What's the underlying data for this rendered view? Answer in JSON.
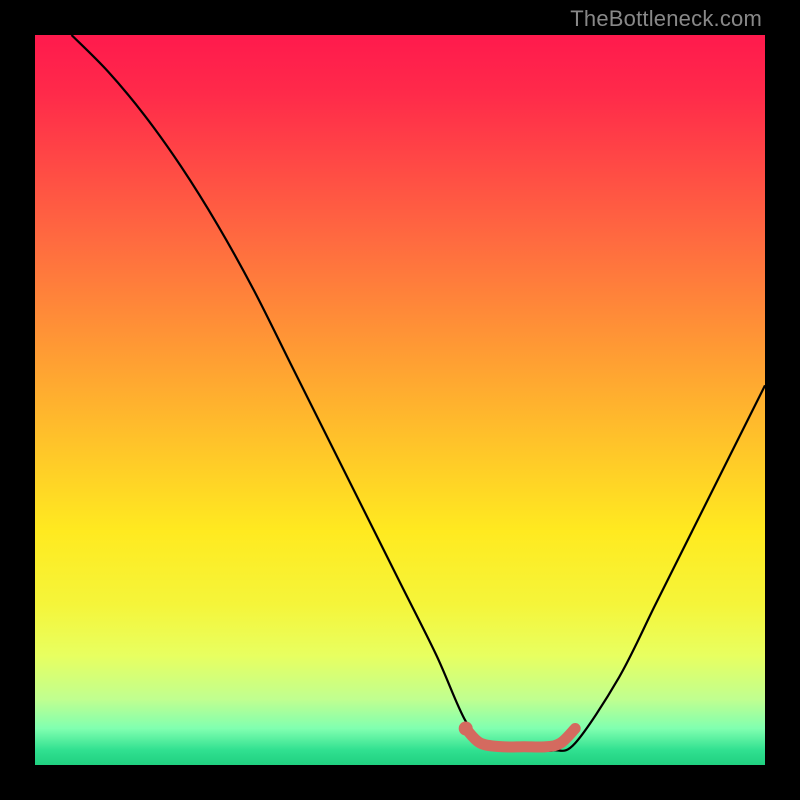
{
  "watermark": "TheBottleneck.com",
  "chart_data": {
    "type": "line",
    "title": "",
    "xlabel": "",
    "ylabel": "",
    "xlim": [
      0,
      100
    ],
    "ylim": [
      0,
      100
    ],
    "series": [
      {
        "name": "bottleneck-curve",
        "x": [
          5,
          10,
          15,
          20,
          25,
          30,
          35,
          40,
          45,
          50,
          55,
          59,
          62,
          65,
          68,
          71,
          74,
          80,
          85,
          90,
          95,
          100
        ],
        "y": [
          100,
          95,
          89,
          82,
          74,
          65,
          55,
          45,
          35,
          25,
          15,
          6,
          3,
          2,
          2,
          2,
          3,
          12,
          22,
          32,
          42,
          52
        ]
      },
      {
        "name": "optimal-marker",
        "x": [
          59,
          61,
          64,
          67,
          70,
          72,
          74
        ],
        "y": [
          5,
          3,
          2.5,
          2.5,
          2.5,
          3,
          5
        ]
      }
    ],
    "optimal_point": {
      "x": 59,
      "y": 5
    }
  },
  "colors": {
    "curve": "#000000",
    "marker": "#d46a5f",
    "background_top": "#ff1a4d",
    "background_bottom": "#20d080"
  }
}
